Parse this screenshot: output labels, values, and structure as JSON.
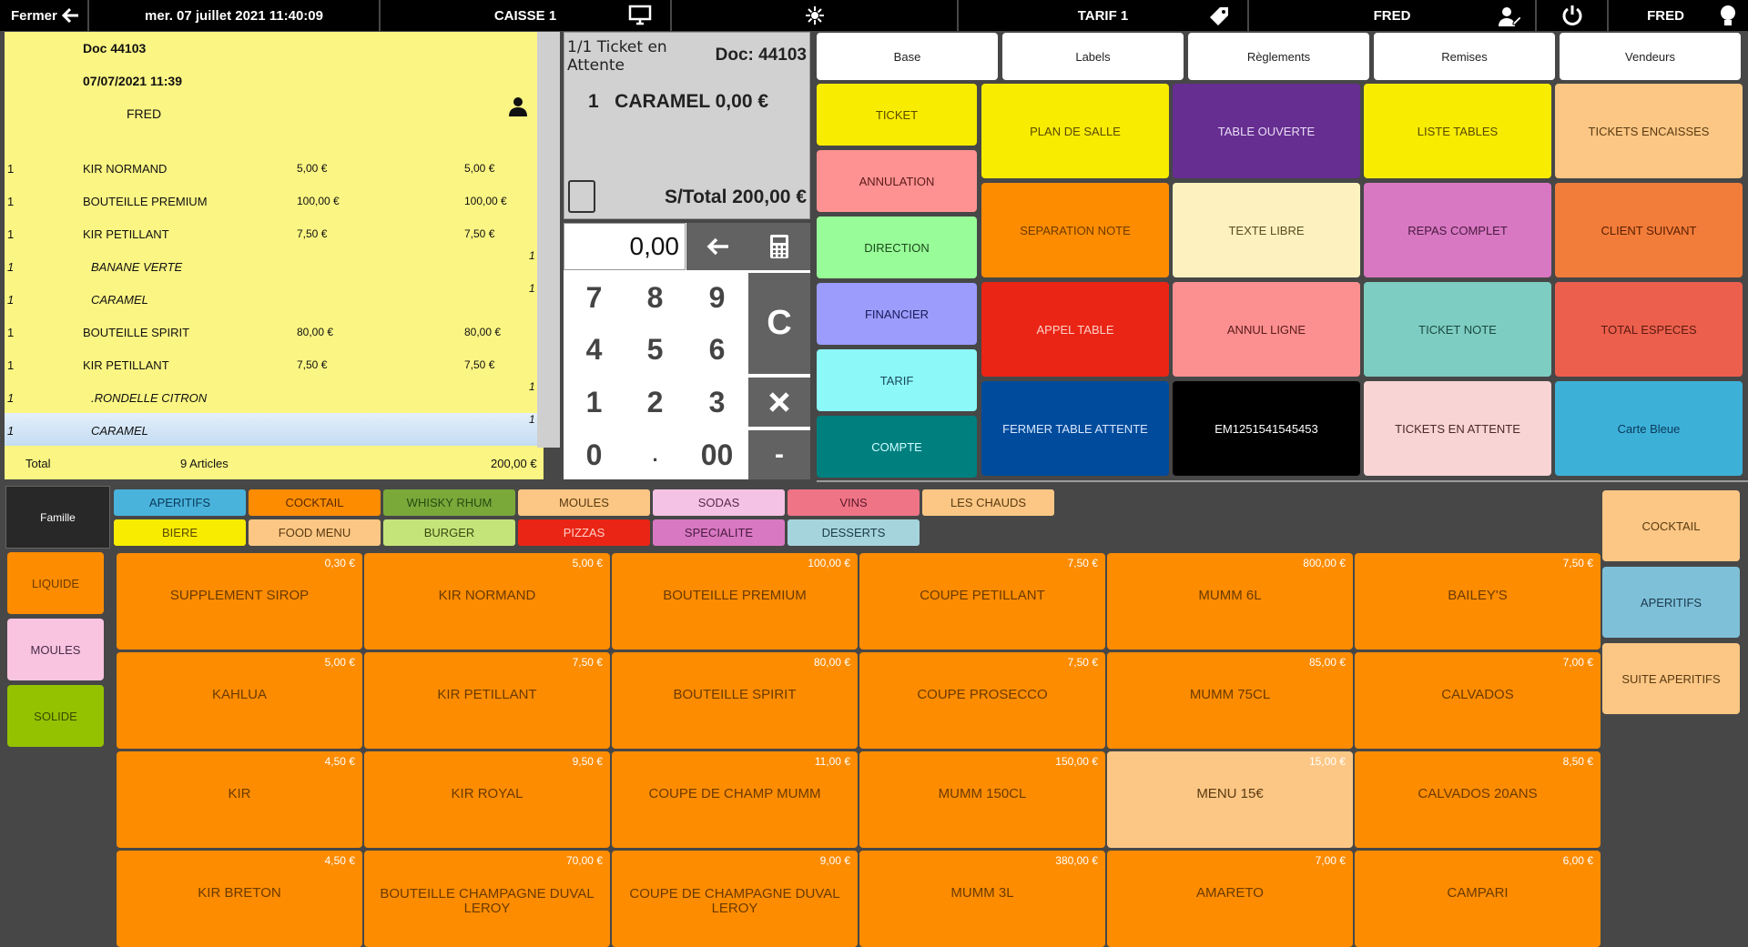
{
  "topbar": {
    "close_label": "Fermer",
    "datetime": "mer. 07 juillet 2021 11:40:09",
    "register": "CAISSE 1",
    "tarif": "TARIF 1",
    "user": "FRED",
    "seller": "FRED"
  },
  "ticket": {
    "doc": "Doc 44103",
    "date": "07/07/2021 11:39",
    "server": "FRED",
    "lines": [
      {
        "qty": "1",
        "name": "KIR NORMAND",
        "price": "5,00 €",
        "total": "5,00 €",
        "sub": false
      },
      {
        "qty": "1",
        "name": "BOUTEILLE PREMIUM",
        "price": "100,00 €",
        "total": "100,00 €",
        "sub": false
      },
      {
        "qty": "1",
        "name": "KIR PETILLANT",
        "price": "7,50 €",
        "total": "7,50 €",
        "sub": false
      },
      {
        "qty": "1",
        "name": "BANANE VERTE",
        "price": "",
        "total": "1",
        "sub": true
      },
      {
        "qty": "1",
        "name": "CARAMEL",
        "price": "",
        "total": "1",
        "sub": true
      },
      {
        "qty": "1",
        "name": "BOUTEILLE SPIRIT",
        "price": "80,00 €",
        "total": "80,00 €",
        "sub": false
      },
      {
        "qty": "1",
        "name": "KIR PETILLANT",
        "price": "7,50 €",
        "total": "7,50 €",
        "sub": false
      },
      {
        "qty": "1",
        "name": ".RONDELLE CITRON",
        "price": "",
        "total": "1",
        "sub": true
      },
      {
        "qty": "1",
        "name": "CARAMEL",
        "price": "",
        "total": "1",
        "sub": true
      }
    ],
    "total_label": "Total",
    "articles": "9 Articles",
    "total": "200,00 €"
  },
  "summary": {
    "wait": "1/1 Ticket en Attente",
    "doc": "Doc: 44103",
    "line": "1   CARAMEL 0,00 €",
    "subtotal": "S/Total 200,00 €"
  },
  "numpad": {
    "display": "0,00",
    "keys": [
      "7",
      "8",
      "9",
      "4",
      "5",
      "6",
      "1",
      "2",
      "3",
      "0",
      ".",
      "00"
    ],
    "clear": "C",
    "minus": "-"
  },
  "tabs": [
    "Base",
    "Labels",
    "Règlements",
    "Remises",
    "Vendeurs"
  ],
  "left_functions": [
    {
      "label": "TICKET",
      "color": "#f8ec00",
      "fg": "#5a4a00"
    },
    {
      "label": "ANNULATION",
      "color": "#fe9292",
      "fg": "#5a1a1a"
    },
    {
      "label": "DIRECTION",
      "color": "#98fc98",
      "fg": "#1a4a1a"
    },
    {
      "label": "FINANCIER",
      "color": "#9c9cfc",
      "fg": "#1a1a5a"
    },
    {
      "label": "TARIF",
      "color": "#8cf8f8",
      "fg": "#1a4a5a"
    },
    {
      "label": "COMPTE",
      "color": "#007f7f",
      "fg": "#cfffff"
    }
  ],
  "functions": [
    {
      "label": "PLAN DE SALLE",
      "color": "#f8ec00",
      "fg": "#5a4a00"
    },
    {
      "label": "TABLE OUVERTE",
      "color": "#662e91",
      "fg": "#e8dcf4"
    },
    {
      "label": "LISTE TABLES",
      "color": "#f8ec00",
      "fg": "#5a4a00"
    },
    {
      "label": "TICKETS ENCAISSES",
      "color": "#fcc785",
      "fg": "#5a3a10"
    },
    {
      "label": "SEPARATION NOTE",
      "color": "#fd8c00",
      "fg": "#6b3a00"
    },
    {
      "label": "TEXTE LIBRE",
      "color": "#fdf2bf",
      "fg": "#5a4a20"
    },
    {
      "label": "REPAS COMPLET",
      "color": "#d878c2",
      "fg": "#4a1a40"
    },
    {
      "label": "CLIENT SUIVANT",
      "color": "#f27c3a",
      "fg": "#5a2000"
    },
    {
      "label": "APPEL TABLE",
      "color": "#ea2515",
      "fg": "#ffd0c8"
    },
    {
      "label": "ANNUL LIGNE",
      "color": "#fc9090",
      "fg": "#5a1a1a"
    },
    {
      "label": "TICKET NOTE",
      "color": "#7ecdc2",
      "fg": "#1a4a40"
    },
    {
      "label": "TOTAL ESPECES",
      "color": "#ec5f4d",
      "fg": "#5a1a10"
    },
    {
      "label": "FERMER TABLE ATTENTE",
      "color": "#004b9b",
      "fg": "#d8e8ff"
    },
    {
      "label": "EM1251541545453",
      "color": "#000000",
      "fg": "#ffffff"
    },
    {
      "label": "TICKETS EN ATTENTE",
      "color": "#f8d4d4",
      "fg": "#4a2a2a"
    },
    {
      "label": "Carte Bleue",
      "color": "#3db0d8",
      "fg": "#0a3a5a"
    }
  ],
  "family_label": "Famille",
  "families": [
    {
      "label": "APERITIFS",
      "color": "#4ab3dc",
      "fg": "#0a3a5a"
    },
    {
      "label": "COCKTAIL",
      "color": "#fd8c00",
      "fg": "#5a2a00"
    },
    {
      "label": "WHISKY RHUM",
      "color": "#7aa93a",
      "fg": "#2a4a10"
    },
    {
      "label": "MOULES",
      "color": "#fcc785",
      "fg": "#5a3a10"
    },
    {
      "label": "SODAS",
      "color": "#f4c2e4",
      "fg": "#5a2a4a"
    },
    {
      "label": "VINS",
      "color": "#ef7486",
      "fg": "#5a1a2a"
    },
    {
      "label": "LES CHAUDS",
      "color": "#fcc785",
      "fg": "#5a3a10"
    },
    {
      "label": "BIERE",
      "color": "#f8ec00",
      "fg": "#5a4a00"
    },
    {
      "label": "FOOD MENU",
      "color": "#fcc785",
      "fg": "#5a3a10"
    },
    {
      "label": "BURGER",
      "color": "#c4e47a",
      "fg": "#3a4a10"
    },
    {
      "label": "PIZZAS",
      "color": "#ea2515",
      "fg": "#ffd0c8"
    },
    {
      "label": "SPECIALITE",
      "color": "#d878c2",
      "fg": "#4a1a40"
    },
    {
      "label": "DESSERTS",
      "color": "#a6d4dd",
      "fg": "#1a3a4a"
    }
  ],
  "categories": [
    {
      "label": "LIQUIDE",
      "color": "#fd8c00",
      "fg": "#6b3a00"
    },
    {
      "label": "MOULES",
      "color": "#f8c4e0",
      "fg": "#4a2a4a"
    },
    {
      "label": "SOLIDE",
      "color": "#94c200",
      "fg": "#3a4a00"
    }
  ],
  "subfamilies": [
    {
      "label": "COCKTAIL",
      "color": "#fcc785",
      "fg": "#5a3a10"
    },
    {
      "label": "APERITIFS",
      "color": "#7fc0d9",
      "fg": "#1a3a4a"
    },
    {
      "label": "SUITE APERITIFS",
      "color": "#fcc785",
      "fg": "#5a3a10"
    }
  ],
  "products": [
    {
      "name": "SUPPLEMENT SIROP",
      "price": "0,30 €"
    },
    {
      "name": "KIR NORMAND",
      "price": "5,00 €"
    },
    {
      "name": "BOUTEILLE PREMIUM",
      "price": "100,00 €"
    },
    {
      "name": "COUPE PETILLANT",
      "price": "7,50 €"
    },
    {
      "name": "MUMM 6L",
      "price": "800,00 €"
    },
    {
      "name": "BAILEY'S",
      "price": "7,50 €"
    },
    {
      "name": "KAHLUA",
      "price": "5,00 €"
    },
    {
      "name": "KIR PETILLANT",
      "price": "7,50 €"
    },
    {
      "name": "BOUTEILLE SPIRIT",
      "price": "80,00 €"
    },
    {
      "name": "COUPE PROSECCO",
      "price": "7,50 €"
    },
    {
      "name": "MUMM 75CL",
      "price": "85,00 €"
    },
    {
      "name": "CALVADOS",
      "price": "7,00 €"
    },
    {
      "name": "KIR",
      "price": "4,50 €"
    },
    {
      "name": "KIR ROYAL",
      "price": "9,50 €"
    },
    {
      "name": "COUPE DE CHAMP MUMM",
      "price": "11,00 €"
    },
    {
      "name": "MUMM 150CL",
      "price": "150,00 €"
    },
    {
      "name": "MENU 15€",
      "price": "15,00 €",
      "light": true
    },
    {
      "name": "CALVADOS 20ANS",
      "price": "8,50 €"
    },
    {
      "name": "KIR BRETON",
      "price": "4,50 €"
    },
    {
      "name": "BOUTEILLE CHAMPAGNE DUVAL LEROY",
      "price": "70,00 €"
    },
    {
      "name": "COUPE DE CHAMPAGNE DUVAL LEROY",
      "price": "9,00 €"
    },
    {
      "name": "MUMM 3L",
      "price": "380,00 €"
    },
    {
      "name": "AMARETO",
      "price": "7,00 €"
    },
    {
      "name": "CAMPARI",
      "price": "6,00 €"
    }
  ]
}
